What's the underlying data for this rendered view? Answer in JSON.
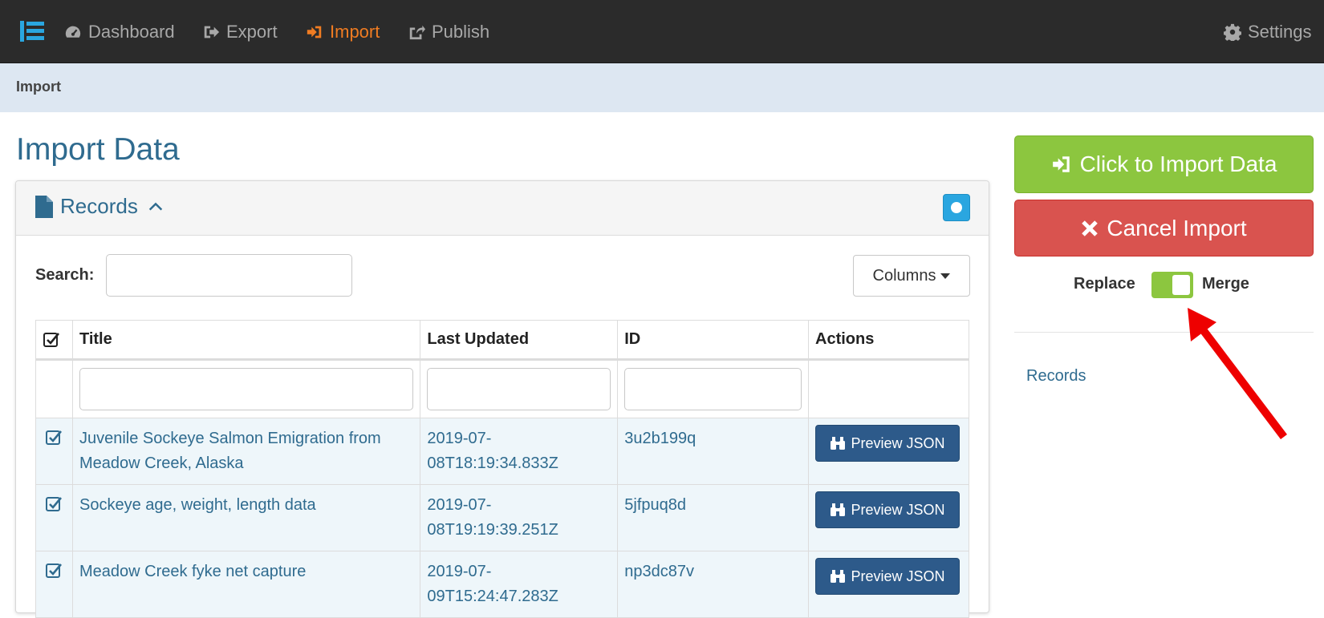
{
  "nav": {
    "brand_icon": "list-logo-icon",
    "items": [
      {
        "label": "Dashboard",
        "icon": "tachometer-icon"
      },
      {
        "label": "Export",
        "icon": "sign-out-icon"
      },
      {
        "label": "Import",
        "icon": "sign-in-icon",
        "active": true
      },
      {
        "label": "Publish",
        "icon": "share-icon"
      }
    ],
    "settings_label": "Settings"
  },
  "breadcrumb": "Import",
  "page_title": "Import Data",
  "panel": {
    "title": "Records",
    "search_label": "Search:",
    "columns_label": "Columns"
  },
  "table": {
    "headers": {
      "title": "Title",
      "updated": "Last Updated",
      "id": "ID",
      "actions": "Actions"
    },
    "rows": [
      {
        "title": "Juvenile Sockeye Salmon Emigration from Meadow Creek, Alaska",
        "updated": "2019-07-08T18:19:34.833Z",
        "id": "3u2b199q",
        "action": "Preview JSON"
      },
      {
        "title": "Sockeye age, weight, length data",
        "updated": "2019-07-08T19:19:39.251Z",
        "id": "5jfpuq8d",
        "action": "Preview JSON"
      },
      {
        "title": "Meadow Creek fyke net capture",
        "updated": "2019-07-09T15:24:47.283Z",
        "id": "np3dc87v",
        "action": "Preview JSON"
      }
    ]
  },
  "sidebar": {
    "import_label": "Click to Import Data",
    "cancel_label": "Cancel Import",
    "replace_label": "Replace",
    "merge_label": "Merge",
    "link_label": "Records"
  },
  "colors": {
    "navbar": "#2b2b2b",
    "active_nav": "#f07c22",
    "breadcrumb_bg": "#dde7f2",
    "import_btn": "#8cc63f",
    "cancel_btn": "#d9534f",
    "preview_btn": "#2d5a8a",
    "annotation_arrow": "#ee0000"
  }
}
